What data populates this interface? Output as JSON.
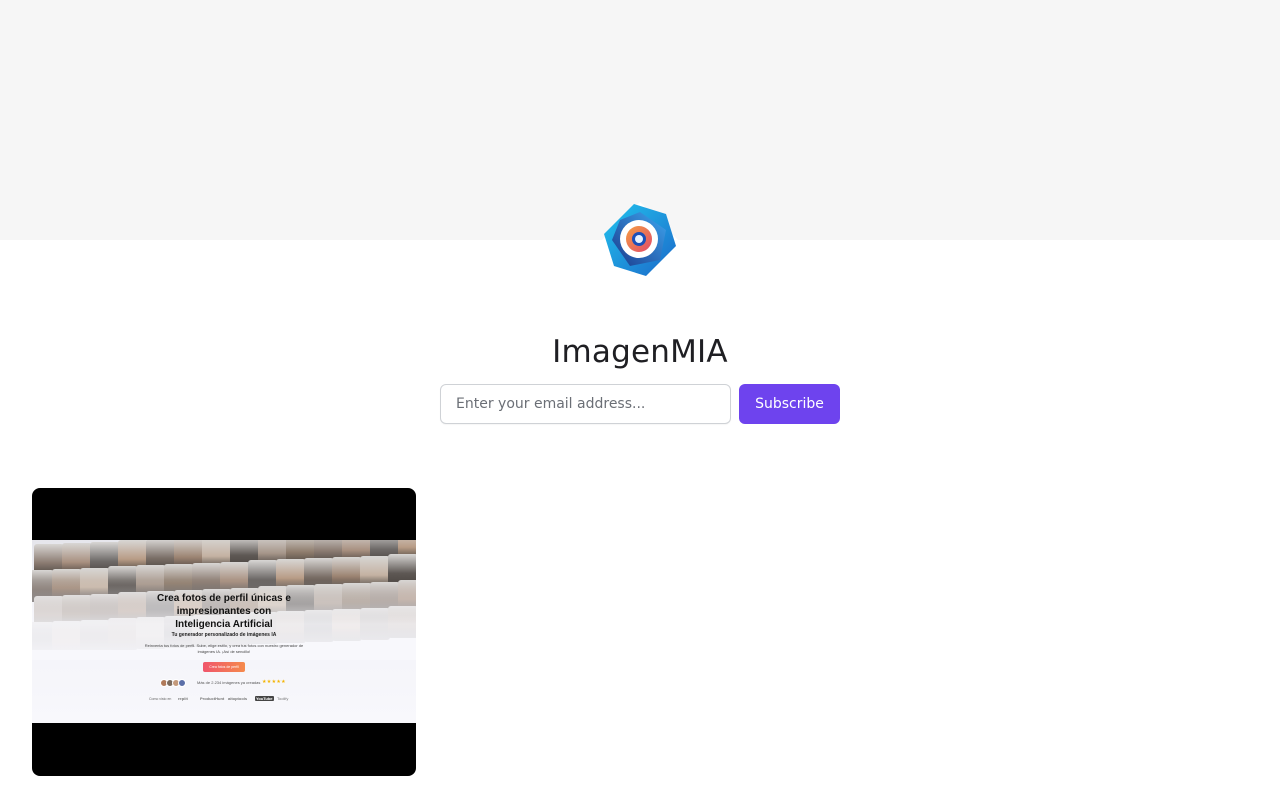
{
  "publication": {
    "name": "ImagenMIA",
    "logo_icon": "aperture-icon"
  },
  "subscribe": {
    "email_placeholder": "Enter your email address...",
    "button_label": "Subscribe"
  },
  "colors": {
    "accent": "#6e43ee",
    "cover_background": "#f6f6f6"
  },
  "posts": [
    {
      "thumbnail": {
        "headline": "Crea fotos de perfil únicas e impresionantes con Inteligencia Artificial",
        "subheadline": "Tu generador personalizado de imágenes IA",
        "description": "Reinventa tus fotos de perfil. Sube, elige estilo, y crea tus fotos con nuestro generador de imágenes IA. ¡Así de sencillo!",
        "cta_label": "Crea fotos de perfil",
        "social_proof": "Más de 2.234 imágenes ya creadas",
        "social_proof_number": "2.234",
        "stars": "★★★★★",
        "featured_label": "Como visto en",
        "brands": [
          "replit",
          "ProductHunt",
          "aitoptools",
          "YouTube",
          "Toolify"
        ]
      }
    }
  ]
}
